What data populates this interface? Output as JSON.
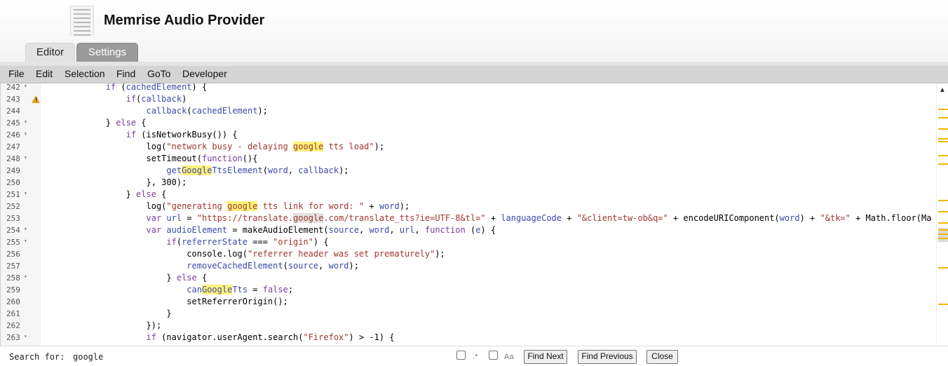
{
  "app": {
    "title": "Memrise Audio Provider",
    "icon": "document-icon"
  },
  "tabs": [
    {
      "label": "Editor",
      "active": false
    },
    {
      "label": "Settings",
      "active": true
    }
  ],
  "menu": [
    "File",
    "Edit",
    "Selection",
    "Find",
    "GoTo",
    "Developer"
  ],
  "gutter": [
    {
      "num": "242",
      "fold": "▾",
      "warn": false
    },
    {
      "num": "243",
      "fold": "",
      "warn": true
    },
    {
      "num": "244",
      "fold": "",
      "warn": false
    },
    {
      "num": "245",
      "fold": "▾",
      "warn": false
    },
    {
      "num": "246",
      "fold": "▾",
      "warn": false
    },
    {
      "num": "247",
      "fold": "",
      "warn": false
    },
    {
      "num": "248",
      "fold": "▾",
      "warn": false
    },
    {
      "num": "249",
      "fold": "",
      "warn": false
    },
    {
      "num": "250",
      "fold": "",
      "warn": false
    },
    {
      "num": "251",
      "fold": "▾",
      "warn": false
    },
    {
      "num": "252",
      "fold": "",
      "warn": false
    },
    {
      "num": "253",
      "fold": "",
      "warn": false
    },
    {
      "num": "254",
      "fold": "▾",
      "warn": false
    },
    {
      "num": "255",
      "fold": "▾",
      "warn": false
    },
    {
      "num": "256",
      "fold": "",
      "warn": false
    },
    {
      "num": "257",
      "fold": "",
      "warn": false
    },
    {
      "num": "258",
      "fold": "▾",
      "warn": false
    },
    {
      "num": "259",
      "fold": "",
      "warn": false
    },
    {
      "num": "260",
      "fold": "",
      "warn": false
    },
    {
      "num": "261",
      "fold": "",
      "warn": false
    },
    {
      "num": "262",
      "fold": "",
      "warn": false
    },
    {
      "num": "263",
      "fold": "▾",
      "warn": false
    }
  ],
  "code_lines": [
    [
      {
        "t": "            "
      },
      {
        "t": "if",
        "c": "#7a3e9d"
      },
      {
        "t": " ("
      },
      {
        "t": "cachedElement",
        "c": "#3b4aa8"
      },
      {
        "t": ") {"
      }
    ],
    [
      {
        "t": "                "
      },
      {
        "t": "if",
        "c": "#7a3e9d"
      },
      {
        "t": "("
      },
      {
        "t": "callback",
        "c": "#3b4aa8"
      },
      {
        "t": ")"
      }
    ],
    [
      {
        "t": "                    "
      },
      {
        "t": "callback",
        "c": "#3b4aa8"
      },
      {
        "t": "("
      },
      {
        "t": "cachedElement",
        "c": "#3b4aa8"
      },
      {
        "t": ");"
      }
    ],
    [
      {
        "t": "            } "
      },
      {
        "t": "else",
        "c": "#7a3e9d"
      },
      {
        "t": " {"
      }
    ],
    [
      {
        "t": "                "
      },
      {
        "t": "if",
        "c": "#7a3e9d"
      },
      {
        "t": " (isNetworkBusy()) {"
      }
    ],
    [
      {
        "t": "                    log("
      },
      {
        "t": "\"network busy - delaying ",
        "c": "#a0362a"
      },
      {
        "t": "google",
        "c": "#a0362a",
        "h": "hl"
      },
      {
        "t": " tts load\"",
        "c": "#a0362a"
      },
      {
        "t": ");"
      }
    ],
    [
      {
        "t": "                    setTimeout("
      },
      {
        "t": "function",
        "c": "#7a3e9d"
      },
      {
        "t": "(){"
      }
    ],
    [
      {
        "t": "                        "
      },
      {
        "t": "get",
        "c": "#3b4aa8"
      },
      {
        "t": "Google",
        "c": "#3b4aa8",
        "h": "hl"
      },
      {
        "t": "TtsElement",
        "c": "#3b4aa8"
      },
      {
        "t": "("
      },
      {
        "t": "word",
        "c": "#3b4aa8"
      },
      {
        "t": ", "
      },
      {
        "t": "callback",
        "c": "#3b4aa8"
      },
      {
        "t": ");"
      }
    ],
    [
      {
        "t": "                    }, 300);"
      }
    ],
    [
      {
        "t": "                } "
      },
      {
        "t": "else",
        "c": "#7a3e9d"
      },
      {
        "t": " {"
      }
    ],
    [
      {
        "t": "                    log("
      },
      {
        "t": "\"generating ",
        "c": "#a0362a"
      },
      {
        "t": "google",
        "c": "#a0362a",
        "h": "hl"
      },
      {
        "t": " tts link for word: \"",
        "c": "#a0362a"
      },
      {
        "t": " + "
      },
      {
        "t": "word",
        "c": "#3b4aa8"
      },
      {
        "t": ");"
      }
    ],
    [
      {
        "t": "                    "
      },
      {
        "t": "var",
        "c": "#7a3e9d"
      },
      {
        "t": " "
      },
      {
        "t": "url",
        "c": "#3b4aa8"
      },
      {
        "t": " = "
      },
      {
        "t": "\"https://translate.",
        "c": "#a0362a"
      },
      {
        "t": "google",
        "c": "#a0362a",
        "h": "hlg"
      },
      {
        "t": ".com/translate_tts?ie=UTF-8&tl=\"",
        "c": "#a0362a"
      },
      {
        "t": " + "
      },
      {
        "t": "languageCode",
        "c": "#3b4aa8"
      },
      {
        "t": " + "
      },
      {
        "t": "\"&client=tw-ob&q=\"",
        "c": "#a0362a"
      },
      {
        "t": " + encodeURIComponent("
      },
      {
        "t": "word",
        "c": "#3b4aa8"
      },
      {
        "t": ") + "
      },
      {
        "t": "\"&tk=\"",
        "c": "#a0362a"
      },
      {
        "t": " + Math.floor(Ma"
      }
    ],
    [
      {
        "t": "                    "
      },
      {
        "t": "var",
        "c": "#7a3e9d"
      },
      {
        "t": " "
      },
      {
        "t": "audioElement",
        "c": "#3b4aa8"
      },
      {
        "t": " = makeAudioElement("
      },
      {
        "t": "source",
        "c": "#3b4aa8"
      },
      {
        "t": ", "
      },
      {
        "t": "word",
        "c": "#3b4aa8"
      },
      {
        "t": ", "
      },
      {
        "t": "url",
        "c": "#3b4aa8"
      },
      {
        "t": ", "
      },
      {
        "t": "function",
        "c": "#7a3e9d"
      },
      {
        "t": " ("
      },
      {
        "t": "e",
        "c": "#3b4aa8"
      },
      {
        "t": ") {"
      }
    ],
    [
      {
        "t": "                        "
      },
      {
        "t": "if",
        "c": "#7a3e9d"
      },
      {
        "t": "("
      },
      {
        "t": "referrerState",
        "c": "#3b4aa8"
      },
      {
        "t": " === "
      },
      {
        "t": "\"origin\"",
        "c": "#a0362a"
      },
      {
        "t": ") {"
      }
    ],
    [
      {
        "t": "                            console.log("
      },
      {
        "t": "\"referrer header was set prematurely\"",
        "c": "#a0362a"
      },
      {
        "t": ");"
      }
    ],
    [
      {
        "t": "                            "
      },
      {
        "t": "removeCachedElement",
        "c": "#3b4aa8"
      },
      {
        "t": "("
      },
      {
        "t": "source",
        "c": "#3b4aa8"
      },
      {
        "t": ", "
      },
      {
        "t": "word",
        "c": "#3b4aa8"
      },
      {
        "t": ");"
      }
    ],
    [
      {
        "t": "                        } "
      },
      {
        "t": "else",
        "c": "#7a3e9d"
      },
      {
        "t": " {"
      }
    ],
    [
      {
        "t": "                            "
      },
      {
        "t": "can",
        "c": "#3b4aa8"
      },
      {
        "t": "Google",
        "c": "#3b4aa8",
        "h": "hl"
      },
      {
        "t": "Tts",
        "c": "#3b4aa8"
      },
      {
        "t": " = "
      },
      {
        "t": "false",
        "c": "#7a3e9d"
      },
      {
        "t": ";"
      }
    ],
    [
      {
        "t": "                            setReferrerOrigin();"
      }
    ],
    [
      {
        "t": "                        }"
      }
    ],
    [
      {
        "t": "                    });"
      }
    ],
    [
      {
        "t": "                    "
      },
      {
        "t": "if",
        "c": "#7a3e9d"
      },
      {
        "t": " (navigator.userAgent.search("
      },
      {
        "t": "\"Firefox\"",
        "c": "#a0362a"
      },
      {
        "t": ") > -1) {"
      }
    ]
  ],
  "search": {
    "label": "Search for:",
    "value": "google",
    "regex_label": ".*",
    "case_label": "Aa",
    "find_next": "Find Next",
    "find_previous": "Find Previous",
    "close": "Close"
  }
}
